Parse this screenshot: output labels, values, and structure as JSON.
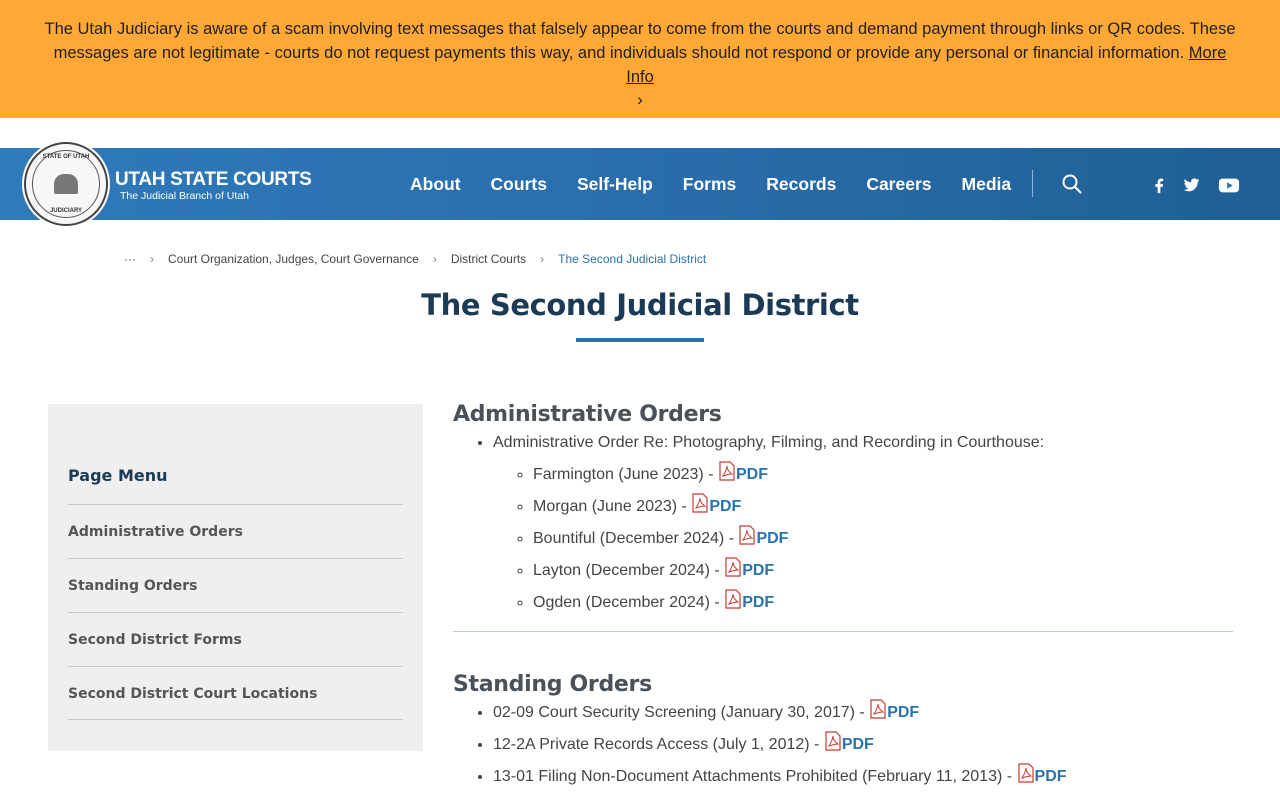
{
  "alert": {
    "text": "The Utah Judiciary is aware of a scam involving text messages that falsely appear to come from the courts and demand payment through links or QR codes. These messages are not legitimate - courts do not request payments this way, and individuals should not respond or provide any personal or financial information.",
    "link_label": "More Info",
    "chevron": "›"
  },
  "header": {
    "seal_top_text": "STATE OF UTAH",
    "seal_bottom_text": "JUDICIARY",
    "brand_title": "UTAH STATE COURTS",
    "brand_subtitle": "The Judicial Branch of Utah",
    "nav": [
      "About",
      "Courts",
      "Self-Help",
      "Forms",
      "Records",
      "Careers",
      "Media"
    ],
    "icons": [
      "search-icon",
      "facebook-icon",
      "twitter-icon",
      "youtube-icon"
    ]
  },
  "breadcrumb": {
    "ellipsis": "···",
    "sep": "›",
    "items": [
      "Court Organization, Judges, Court Governance",
      "District Courts"
    ],
    "current": "The Second Judicial District"
  },
  "page_title": "The Second Judicial District",
  "sidebar": {
    "title": "Page Menu",
    "items": [
      "Administrative Orders",
      "Standing Orders",
      "Second District Forms",
      "Second District Court Locations"
    ]
  },
  "sections": {
    "admin": {
      "title": "Administrative Orders",
      "item": "Administrative Order Re: Photography, Filming, and Recording in Courthouse:",
      "subitems": [
        "Farmington (June 2023) - ",
        "Morgan (June 2023) - ",
        "Bountiful (December 2024) - ",
        "Layton (December 2024) - ",
        "Ogden (December 2024) - "
      ]
    },
    "standing": {
      "title": "Standing Orders",
      "items": [
        "02-09 Court Security Screening (January 30, 2017) - ",
        "12-2A Private Records Access (July 1, 2012) - ",
        "13-01 Filing Non-Document Attachments Prohibited (February 11, 2013) - "
      ]
    },
    "pdf_label": "PDF"
  },
  "colors": {
    "alert_bg": "#ffa836",
    "header_blue": "#2a6fae",
    "link_blue": "#2a73ad",
    "title_navy": "#1b3a55"
  }
}
